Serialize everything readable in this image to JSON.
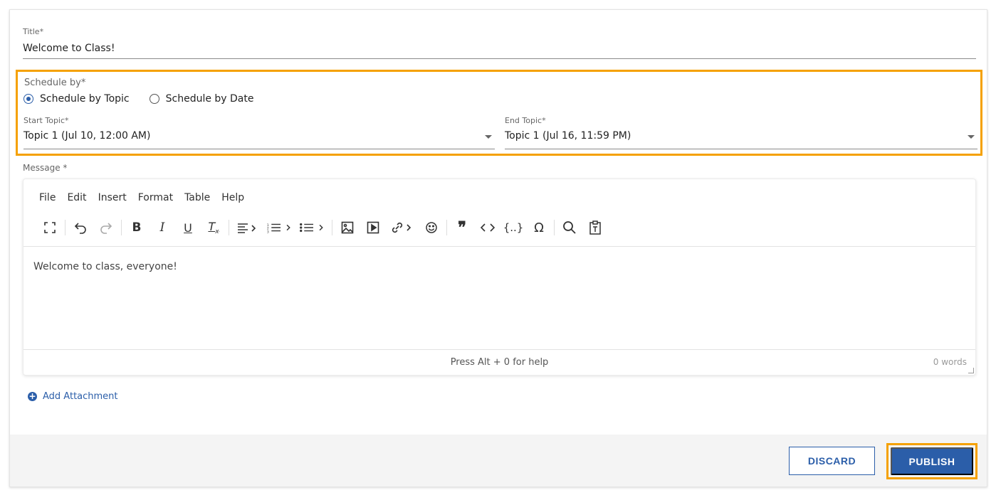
{
  "form": {
    "title_label": "Title*",
    "title_value": "Welcome to Class!",
    "schedule_label": "Schedule by*",
    "schedule_options": [
      "Schedule by Topic",
      "Schedule by Date"
    ],
    "schedule_selected": "Schedule by Topic",
    "start_topic_label": "Start Topic*",
    "start_topic_value": "Topic 1 (Jul 10, 12:00 AM)",
    "end_topic_label": "End Topic*",
    "end_topic_value": "Topic 1 (Jul 16, 11:59 PM)",
    "message_label": "Message *"
  },
  "editor": {
    "menu": [
      "File",
      "Edit",
      "Insert",
      "Format",
      "Table",
      "Help"
    ],
    "toolbar_icons": [
      "fullscreen-icon",
      "undo-icon",
      "redo-icon",
      "bold-icon",
      "italic-icon",
      "underline-icon",
      "clear-format-icon",
      "align-icon",
      "numbered-list-icon",
      "bullet-list-icon",
      "image-icon",
      "media-icon",
      "link-icon",
      "emoji-icon",
      "quote-icon",
      "code-icon",
      "code-block-icon",
      "special-char-icon",
      "search-icon",
      "paste-text-icon"
    ],
    "content": "Welcome to class, everyone!",
    "help_text": "Press Alt + 0 for help",
    "word_count": "0 words"
  },
  "attachment": {
    "label": "Add Attachment"
  },
  "footer": {
    "discard_label": "DISCARD",
    "publish_label": "PUBLISH"
  },
  "colors": {
    "accent": "#2b5ea9",
    "highlight": "#f5a100"
  }
}
